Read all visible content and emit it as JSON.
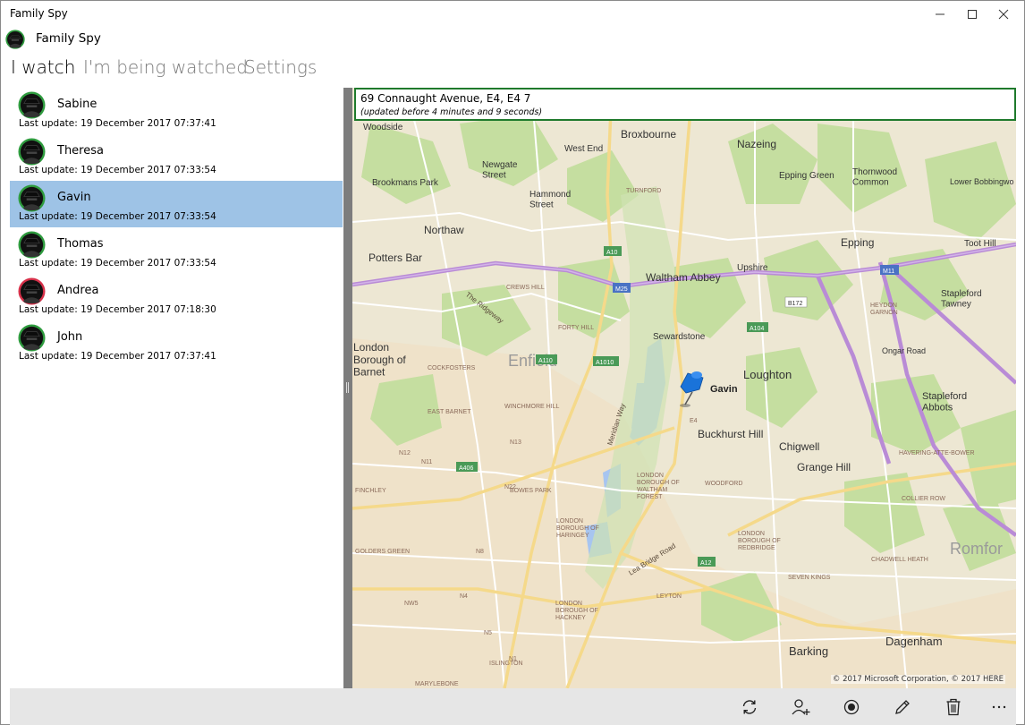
{
  "window": {
    "title": "Family Spy"
  },
  "app": {
    "name": "Family Spy"
  },
  "tabs": [
    {
      "label": "I watch"
    },
    {
      "label": "I'm being watched"
    },
    {
      "label": "Settings"
    }
  ],
  "people": [
    {
      "name": "Sabine",
      "last_update": "Last update: 19 December 2017 07:37:41",
      "status_color": "#2e9b3e"
    },
    {
      "name": "Theresa",
      "last_update": "Last update: 19 December 2017 07:33:54",
      "status_color": "#2e9b3e"
    },
    {
      "name": "Gavin",
      "last_update": "Last update: 19 December 2017 07:33:54",
      "status_color": "#2e9b3e",
      "selected": true
    },
    {
      "name": "Thomas",
      "last_update": "Last update: 19 December 2017 07:33:54",
      "status_color": "#2e9b3e"
    },
    {
      "name": "Andrea",
      "last_update": "Last update: 19 December 2017 07:18:30",
      "status_color": "#d63049"
    },
    {
      "name": "John",
      "last_update": "Last update: 19 December 2017 07:37:41",
      "status_color": "#2e9b3e"
    }
  ],
  "location": {
    "address": "69 Connaught Avenue, E4, E4 7",
    "updated": "(updated before 4 minutes and 9 seconds)"
  },
  "map": {
    "pin_label": "Gavin",
    "copyright": "© 2017 Microsoft Corporation, © 2017 HERE",
    "places": {
      "woodside": "Woodside",
      "broxbourne": "Broxbourne",
      "nazeing": "Nazeing",
      "west_end": "West End",
      "newgate_street": "Newgate\nStreet",
      "brookmans_park": "Brookmans Park",
      "hammond_street": "Hammond\nStreet",
      "turnford": "TURNFORD",
      "epping_green": "Epping Green",
      "thornwood_common": "Thornwood\nCommon",
      "lower_bobbingworth": "Lower Bobbingwo",
      "northaw": "Northaw",
      "epping": "Epping",
      "toot_hill": "Toot Hill",
      "potters_bar": "Potters Bar",
      "waltham_abbey": "Waltham Abbey",
      "upshire": "Upshire",
      "crews_hill": "CREWS HILL",
      "the_ridgeway": "The Ridgeway",
      "stapleford_tawney": "Stapleford\nTawney",
      "heydon_garnon": "HEYDON\nGARNON",
      "forty_hill": "FORTY HILL",
      "sewardstone": "Sewardstone",
      "ongar_road": "Ongar Road",
      "london_borough_of_barnet": "London\nBorough of\nBarnet",
      "cockfosters": "COCKFOSTERS",
      "enfield": "Enfield",
      "loughton": "Loughton",
      "east_barnet": "EAST BARNET",
      "winchmore_hill": "WINCHMORE HILL",
      "meridian_way": "Meridian Way",
      "stapleford_abbots": "Stapleford\nAbbots",
      "buckhurst_hill": "Buckhurst Hill",
      "chigwell": "Chigwell",
      "grange_hill": "Grange Hill",
      "havering_atte_bower": "HAVERING-ATTE-BOWER",
      "finchley": "FINCHLEY",
      "bowes_park": "BOWES PARK",
      "london_borough_of_waltham_forest": "LONDON\nBOROUGH OF\nWALTHAM\nFOREST",
      "woodford": "WOODFORD",
      "collier_row": "COLLIER ROW",
      "london_borough_of_haringey": "LONDON\nBOROUGH OF\nHARINGEY",
      "london_borough_of_redbridge": "LONDON\nBOROUGH OF\nREDBRIDGE",
      "golders_green": "GOLDERS GREEN",
      "lea_bridge_road": "Lea Bridge Road",
      "romford": "Romfor",
      "chadwell_heath": "CHADWELL HEATH",
      "seven_kings": "SEVEN KINGS",
      "leyton": "LEYTON",
      "london_borough_of_hackney": "LONDON\nBOROUGH OF\nHACKNEY",
      "barking": "Barking",
      "dagenham": "Dagenham",
      "islington": "ISLINGTON",
      "marylebone": "MARYLEBONE"
    },
    "road_shields": {
      "a10": "A10",
      "m25": "M25",
      "m11": "M11",
      "b172": "B172",
      "a104": "A104",
      "a110": "A110",
      "a1010": "A1010",
      "a406": "A406",
      "a12": "A12",
      "n12": "N12",
      "n13": "N13",
      "n22": "N22",
      "n11": "N11",
      "n8": "N8",
      "nw5": "NW5",
      "n5": "N5",
      "n1": "N1",
      "n4": "N4",
      "e4": "E4"
    }
  },
  "colors": {
    "accent_border": "#1f7a2c",
    "selection": "#9ec3e6",
    "pin": "#1a73d9",
    "motorway": "#b98bd6"
  },
  "icons": {
    "refresh": "refresh-icon",
    "add_person": "add-person-icon",
    "record": "record-icon",
    "edit": "pencil-icon",
    "delete": "trash-icon",
    "more": "more-icon"
  }
}
